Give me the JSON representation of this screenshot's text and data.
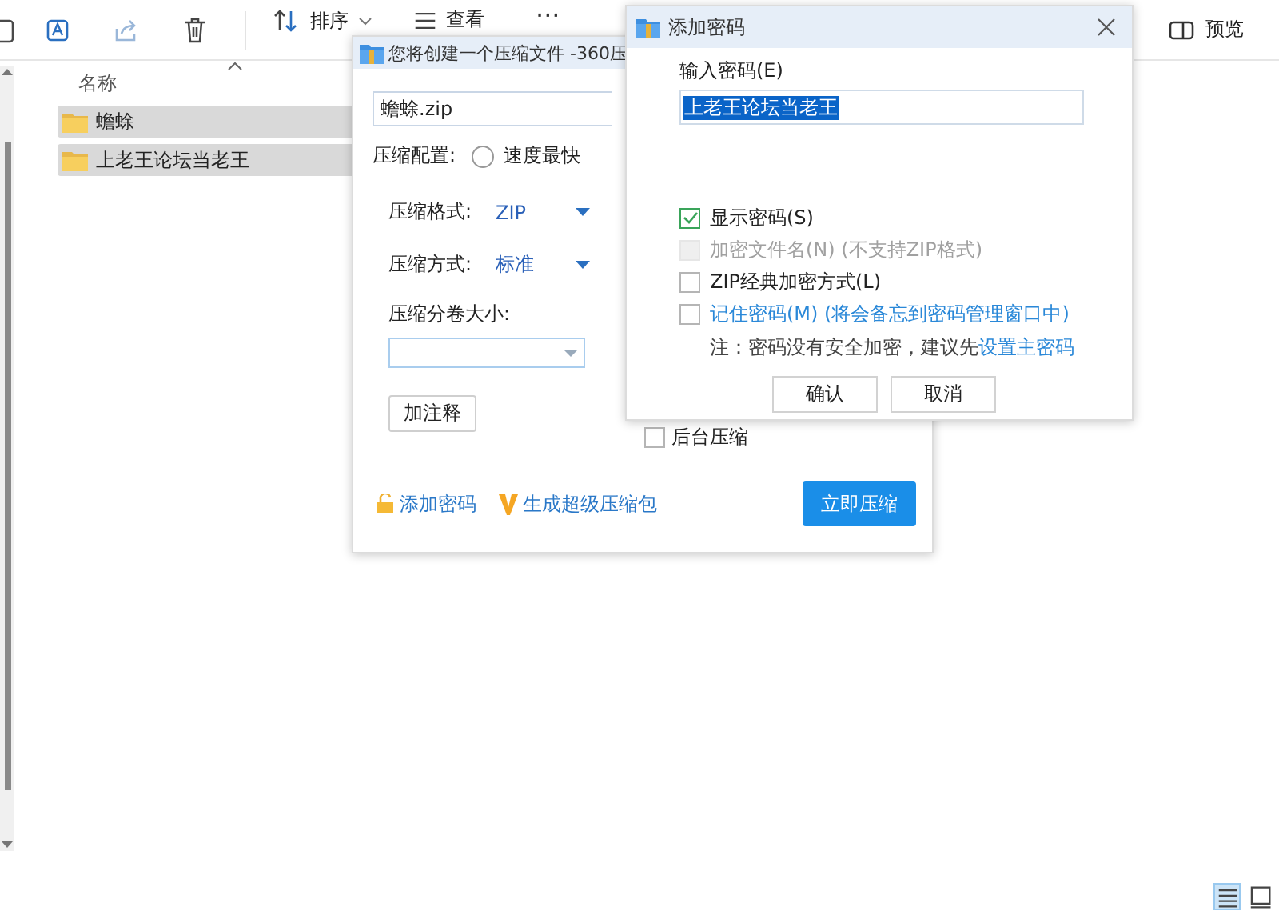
{
  "toolbar": {
    "sort_label": "排序",
    "view_label": "查看",
    "more": "···",
    "preview_label": "预览"
  },
  "file_list": {
    "column": "名称",
    "rows": [
      {
        "name": "蟾蜍",
        "selected": true
      },
      {
        "name": "上老王论坛当老王",
        "selected": true
      }
    ]
  },
  "view_buttons": [
    {
      "kind": "details",
      "selected": true
    },
    {
      "kind": "tiles",
      "selected": false
    }
  ],
  "compress_dialog": {
    "title": "您将创建一个压缩文件 -360压",
    "filename": "蟾蜍.zip",
    "profile": {
      "label": "压缩配置:",
      "option": "速度最快",
      "selected": false
    },
    "format": {
      "label": "压缩格式:",
      "value": "ZIP"
    },
    "method": {
      "label": "压缩方式:",
      "value": "标准"
    },
    "volume": {
      "label": "压缩分卷大小:"
    },
    "comment_button": "加注释",
    "background": {
      "label": "后台压缩",
      "checked": false
    },
    "add_password": "添加密码",
    "super_package": "生成超级压缩包",
    "compress_button": "立即压缩"
  },
  "password_dialog": {
    "title": "添加密码",
    "field_label": "输入密码(E)",
    "password": "上老王论坛当老王",
    "text_selected": true,
    "options": [
      {
        "kind": "plain",
        "label": "显示密码(S)",
        "checked": true,
        "disabled": false
      },
      {
        "kind": "plain",
        "label": "加密文件名(N) (不支持ZIP格式)",
        "checked": false,
        "disabled": true
      },
      {
        "kind": "plain",
        "label": "ZIP经典加密方式(L)",
        "checked": false,
        "disabled": false
      },
      {
        "kind": "link",
        "label": "记住密码(M) (将会备忘到密码管理窗口中)",
        "checked": false,
        "disabled": false
      }
    ],
    "note": "注：密码没有安全加密，建议先",
    "note_link": "设置主密码",
    "buttons": [
      "确认",
      "取消"
    ]
  }
}
